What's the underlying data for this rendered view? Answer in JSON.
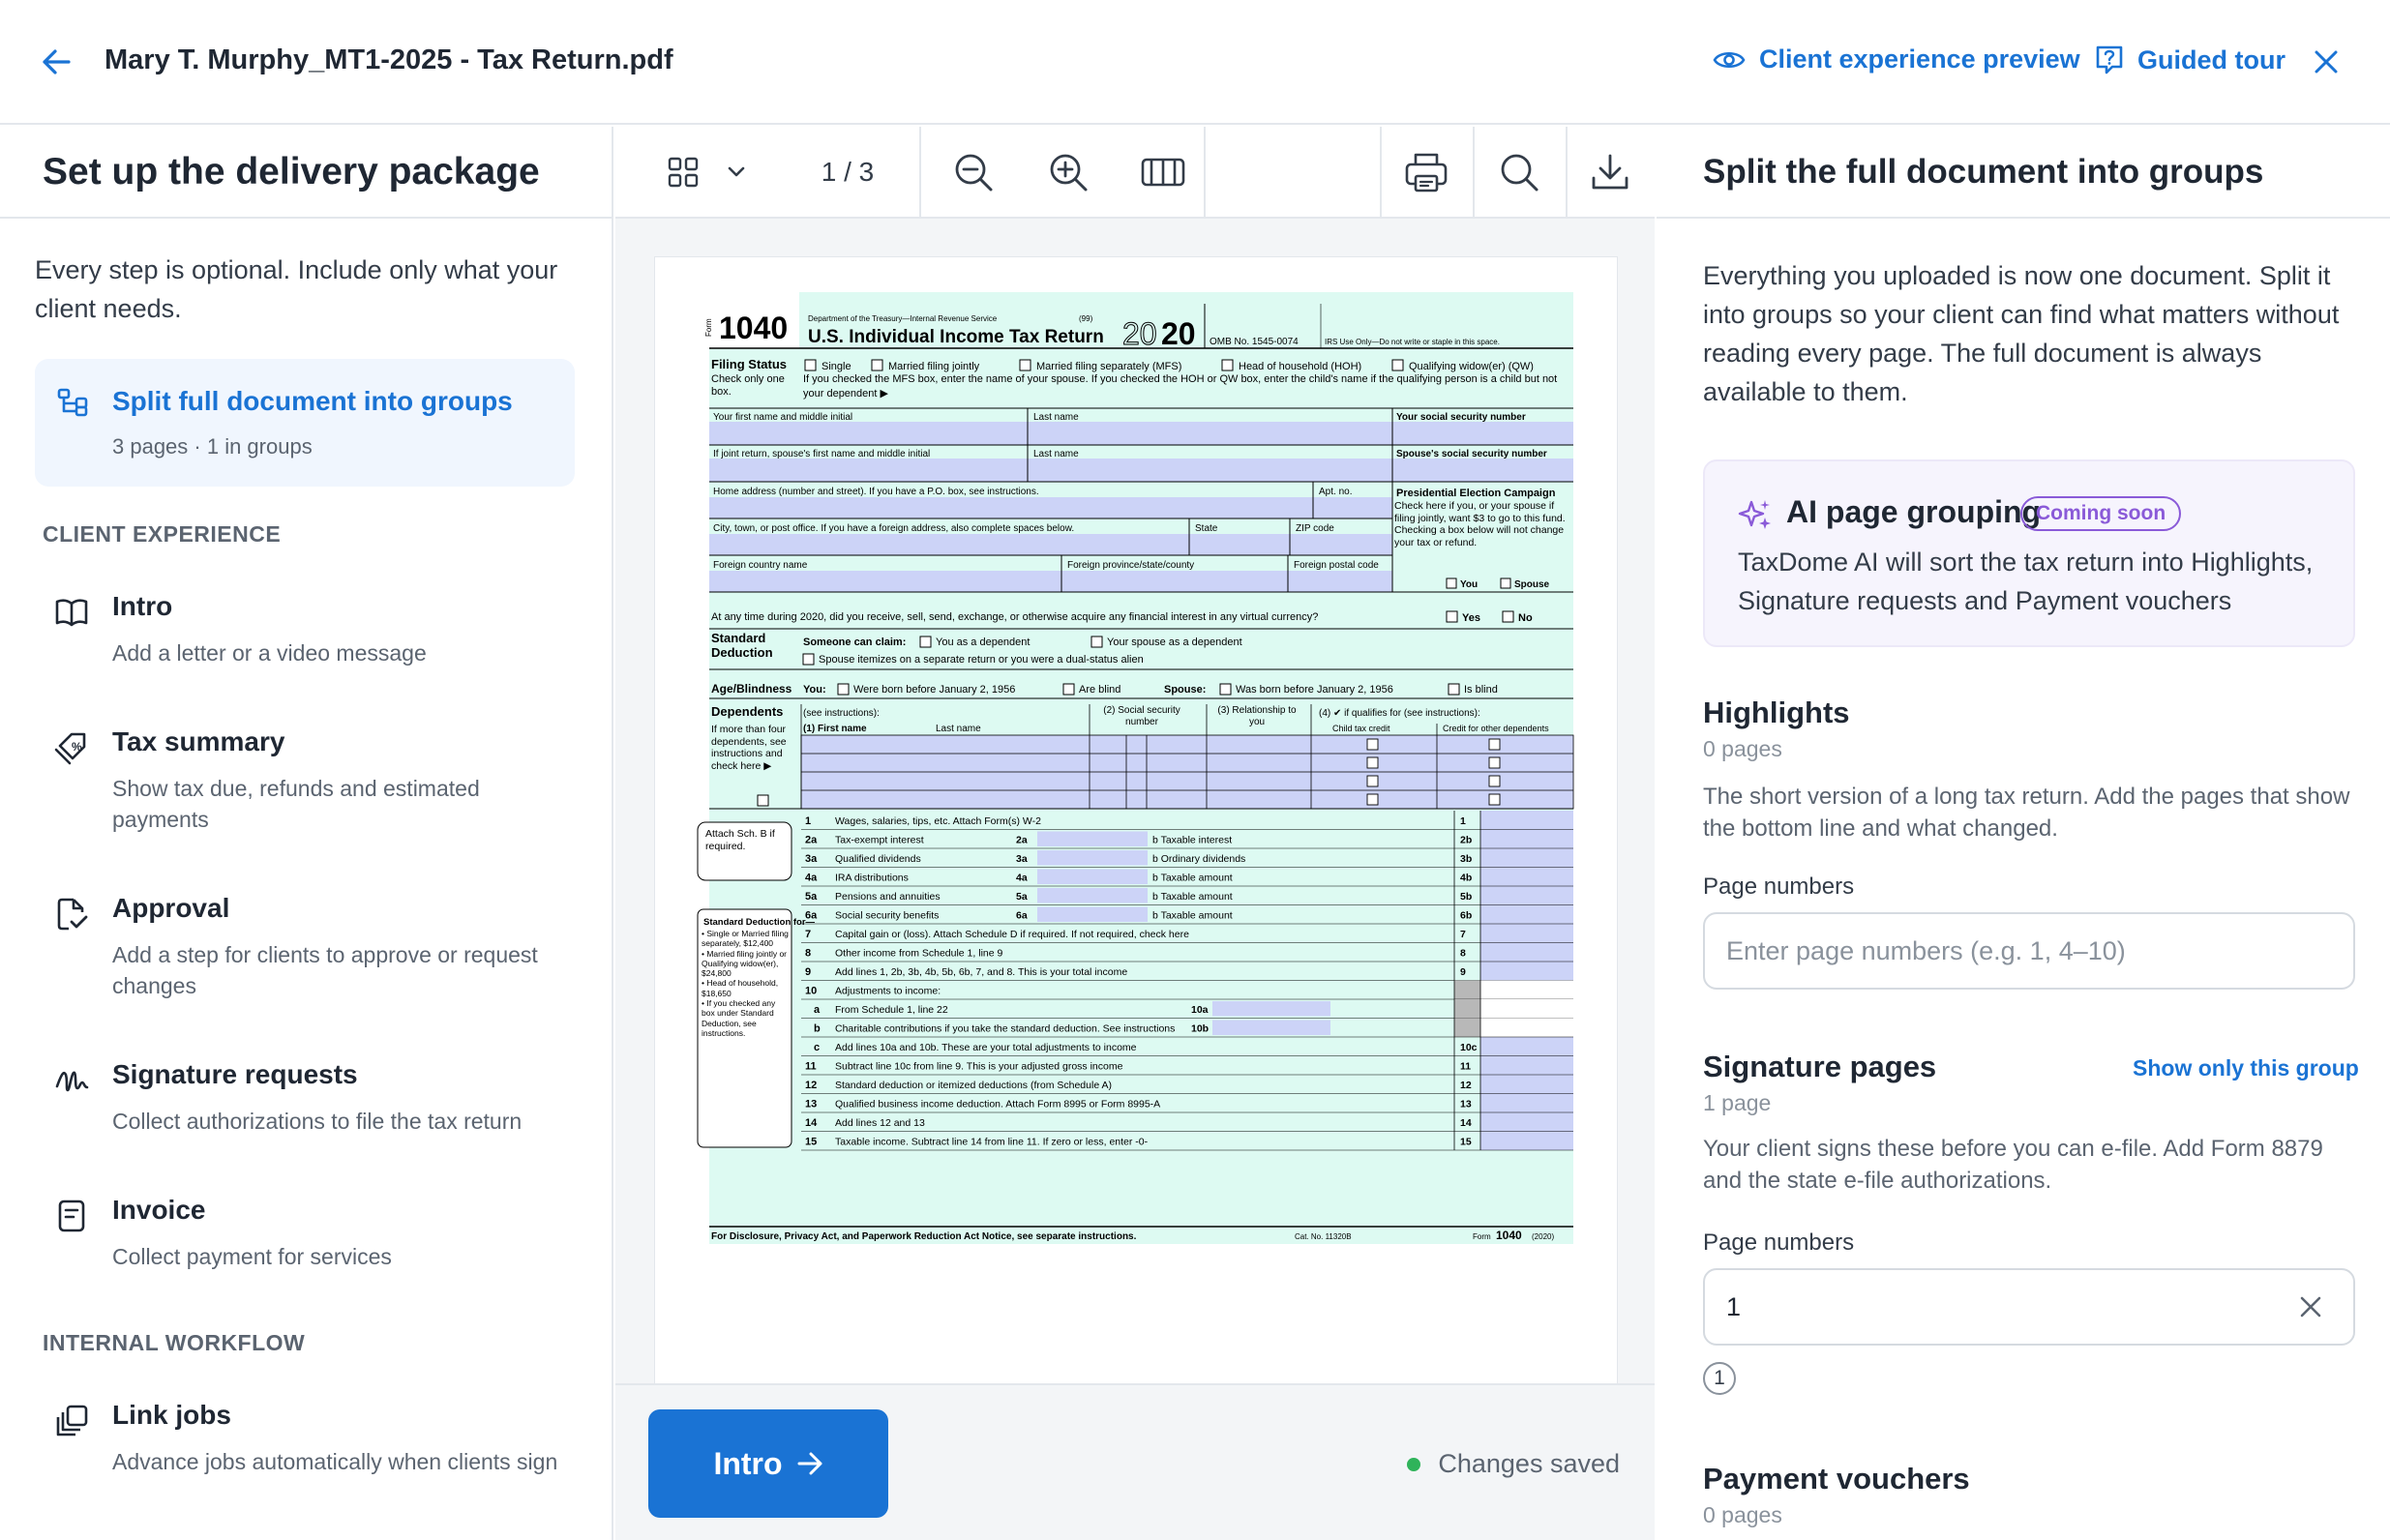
{
  "header": {
    "document_title": "Mary T. Murphy_MT1-2025 - Tax Return.pdf",
    "client_preview_label": "Client experience preview",
    "guided_tour_label": "Guided tour"
  },
  "left_panel": {
    "title": "Set up the delivery package",
    "intro": "Every step is optional. Include only what your client needs.",
    "active_step": {
      "title": "Split full document into groups",
      "subtitle": "3 pages · 1 in groups",
      "icon": "split-icon"
    },
    "client_experience_label": "CLIENT EXPERIENCE",
    "client_steps": [
      {
        "title": "Intro",
        "subtitle": "Add a letter or a video message",
        "icon": "book-icon"
      },
      {
        "title": "Tax summary",
        "subtitle": "Show tax due, refunds and estimated payments",
        "icon": "tax-tag-icon"
      },
      {
        "title": "Approval",
        "subtitle": "Add a step for clients to approve or request changes",
        "icon": "approval-doc-icon"
      },
      {
        "title": "Signature requests",
        "subtitle": "Collect authorizations to file the tax return",
        "icon": "signature-icon"
      },
      {
        "title": "Invoice",
        "subtitle": "Collect payment for services",
        "icon": "invoice-icon"
      }
    ],
    "internal_workflow_label": "INTERNAL WORKFLOW",
    "internal_steps": [
      {
        "title": "Link jobs",
        "subtitle": "Advance jobs automatically when clients sign",
        "icon": "link-jobs-icon"
      }
    ]
  },
  "viewer": {
    "page_indicator": "1 / 3",
    "next_button_label": "Intro",
    "save_status": "Changes saved",
    "status_color": "#2fb35a"
  },
  "form1040": {
    "form_label": "Form",
    "form_number": "1040",
    "dept": "Department of the Treasury—Internal Revenue Service",
    "code": "(99)",
    "form_title": "U.S. Individual Income Tax Return",
    "year_outline": "20",
    "year_bold": "20",
    "omb": "OMB No. 1545-0074",
    "irs_only": "IRS Use Only—Do not write or staple in this space.",
    "filing_status": "Filing Status",
    "filing_check": "Check only one box.",
    "statuses": [
      "Single",
      "Married filing jointly",
      "Married filing separately (MFS)",
      "Head of household (HOH)",
      "Qualifying widow(er) (QW)"
    ],
    "mfs_note": "If you checked the MFS box, enter the name of your spouse. If you checked the HOH or QW box, enter the child's name if the qualifying person is a child but not your dependent ▶",
    "name_rows": [
      [
        "Your first name and middle initial",
        "Last name",
        "Your social security number"
      ],
      [
        "If joint return, spouse's first name and middle initial",
        "Last name",
        "Spouse's social security number"
      ]
    ],
    "home_address": "Home address (number and street). If you have a P.O. box, see instructions.",
    "apt": "Apt. no.",
    "city": "City, town, or post office. If you have a foreign address, also complete spaces below.",
    "state": "State",
    "zip": "ZIP code",
    "foreign_country": "Foreign country name",
    "foreign_province": "Foreign province/state/county",
    "foreign_postal": "Foreign postal code",
    "pec_title": "Presidential Election Campaign",
    "pec_text": "Check here if you, or your spouse if filing jointly, want $3 to go to this fund. Checking a box below will not change your tax or refund.",
    "pec_you": "You",
    "pec_spouse": "Spouse",
    "virtual_currency": "At any time during 2020, did you receive, sell, send, exchange, or otherwise acquire any financial interest in any virtual currency?",
    "yes": "Yes",
    "no": "No",
    "std_deduction": "Standard Deduction",
    "someone_claim": "Someone can claim:",
    "as_dependent": "You as a dependent",
    "spouse_dependent": "Your spouse as a dependent",
    "spouse_itemizes": "Spouse itemizes on a separate return or you were a dual-status alien",
    "age_blindness": "Age/Blindness",
    "you_label": "You:",
    "born_before": "Were born before January 2, 1956",
    "are_blind": "Are blind",
    "spouse_label": "Spouse:",
    "spouse_born": "Was born before January 2, 1956",
    "is_blind": "Is blind",
    "dependents": "Dependents",
    "see_instructions": "(see instructions):",
    "dep_first": "(1) First name",
    "dep_last": "Last name",
    "dep_ssn": "(2) Social security number",
    "dep_rel": "(3) Relationship to you",
    "dep_qual": "(4) ✔ if qualifies for (see instructions):",
    "dep_ctc": "Child tax credit",
    "dep_odc": "Credit for other dependents",
    "more_than_four": "If more than four dependents, see instructions and check here ▶",
    "attach_sch": "Attach Sch. B if required.",
    "std_box_title": "Standard Deduction for—",
    "std_box_items": [
      "• Single or Married filing separately, $12,400",
      "• Married filing jointly or Qualifying widow(er), $24,800",
      "• Head of household, $18,650",
      "• If you checked any box under Standard Deduction, see instructions."
    ],
    "lines": [
      {
        "n": "1",
        "t": "Wages, salaries, tips, etc. Attach Form(s) W-2",
        "r": "1"
      },
      {
        "n": "2a",
        "t": "Tax-exempt interest",
        "m": "2a",
        "b": "b  Taxable interest",
        "r": "2b"
      },
      {
        "n": "3a",
        "t": "Qualified dividends",
        "m": "3a",
        "b": "b  Ordinary dividends",
        "r": "3b"
      },
      {
        "n": "4a",
        "t": "IRA distributions",
        "m": "4a",
        "b": "b  Taxable amount",
        "r": "4b"
      },
      {
        "n": "5a",
        "t": "Pensions and annuities",
        "m": "5a",
        "b": "b  Taxable amount",
        "r": "5b"
      },
      {
        "n": "6a",
        "t": "Social security benefits",
        "m": "6a",
        "b": "b  Taxable amount",
        "r": "6b"
      },
      {
        "n": "7",
        "t": "Capital gain or (loss). Attach Schedule D if required. If not required, check here",
        "r": "7"
      },
      {
        "n": "8",
        "t": "Other income from Schedule 1, line 9",
        "r": "8"
      },
      {
        "n": "9",
        "t": "Add lines 1, 2b, 3b, 4b, 5b, 6b, 7, and 8. This is your total income",
        "r": "9"
      },
      {
        "n": "10",
        "t": "Adjustments to income:",
        "r": ""
      },
      {
        "n": "a",
        "t": "From Schedule 1, line 22",
        "m": "10a",
        "r": ""
      },
      {
        "n": "b",
        "t": "Charitable contributions if you take the standard deduction. See instructions",
        "m": "10b",
        "r": ""
      },
      {
        "n": "c",
        "t": "Add lines 10a and 10b. These are your total adjustments to income",
        "r": "10c"
      },
      {
        "n": "11",
        "t": "Subtract line 10c from line 9. This is your adjusted gross income",
        "r": "11"
      },
      {
        "n": "12",
        "t": "Standard deduction or itemized deductions (from Schedule A)",
        "r": "12"
      },
      {
        "n": "13",
        "t": "Qualified business income deduction. Attach Form 8995 or Form 8995-A",
        "r": "13"
      },
      {
        "n": "14",
        "t": "Add lines 12 and 13",
        "r": "14"
      },
      {
        "n": "15",
        "t": "Taxable income. Subtract line 14 from line 11. If zero or less, enter -0-",
        "r": "15"
      }
    ],
    "footer_left": "For Disclosure, Privacy Act, and Paperwork Reduction Act Notice, see separate instructions.",
    "footer_cat": "Cat. No. 11320B",
    "footer_right_form": "Form",
    "footer_right_num": "1040",
    "footer_right_year": "(2020)"
  },
  "right_panel": {
    "title": "Split the full document into groups",
    "description": "Everything you uploaded is now one document. Split it into groups so your client can find what matters without reading every page. The full document is always available to them.",
    "ai_card": {
      "title": "AI page grouping",
      "badge": "Coming soon",
      "description": "TaxDome AI will sort the tax return into Highlights, Signature requests and Payment vouchers",
      "accent": "#8a5ad8"
    },
    "highlights": {
      "title": "Highlights",
      "count": "0 pages",
      "description": "The short version of a long tax return. Add the pages that show the bottom line and what changed.",
      "field_label": "Page numbers",
      "placeholder": "Enter page numbers (e.g. 1, 4–10)"
    },
    "signature_pages": {
      "title": "Signature pages",
      "show_only": "Show only this group",
      "count": "1 page",
      "description": "Your client signs these before you can e-file. Add Form 8879 and the state e-file authorizations.",
      "field_label": "Page numbers",
      "value": "1",
      "chips": [
        "1"
      ]
    },
    "payment_vouchers": {
      "title": "Payment vouchers",
      "count": "0 pages"
    }
  },
  "colors": {
    "accent": "#1a73d4",
    "form_green": "#ddfaf2",
    "form_blue": "#ccd3f7"
  }
}
